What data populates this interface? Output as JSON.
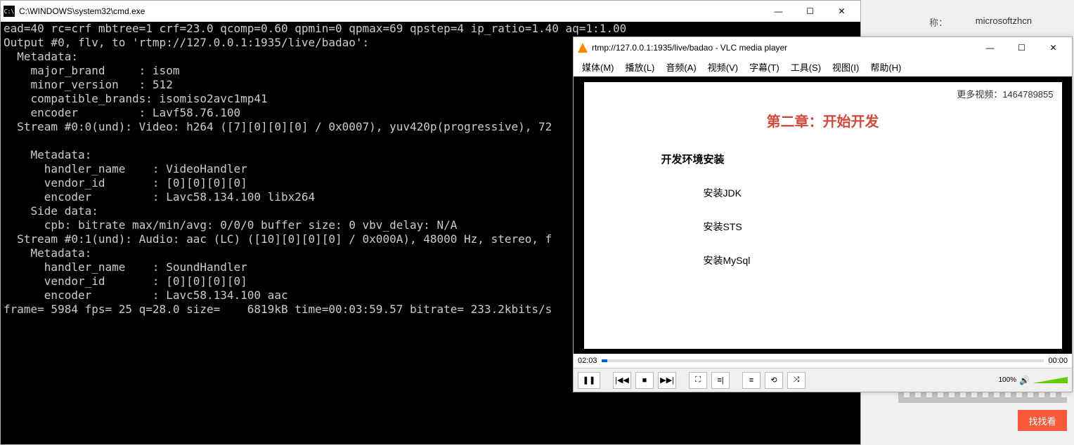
{
  "cmd": {
    "title": "C:\\WINDOWS\\system32\\cmd.exe",
    "output": "ead=40 rc=crf mbtree=1 crf=23.0 qcomp=0.60 qpmin=0 qpmax=69 qpstep=4 ip_ratio=1.40 aq=1:1.00\nOutput #0, flv, to 'rtmp://127.0.0.1:1935/live/badao':\n  Metadata:\n    major_brand     : isom\n    minor_version   : 512\n    compatible_brands: isomiso2avc1mp41\n    encoder         : Lavf58.76.100\n  Stream #0:0(und): Video: h264 ([7][0][0][0] / 0x0007), yuv420p(progressive), 72\n\n    Metadata:\n      handler_name    : VideoHandler\n      vendor_id       : [0][0][0][0]\n      encoder         : Lavc58.134.100 libx264\n    Side data:\n      cpb: bitrate max/min/avg: 0/0/0 buffer size: 0 vbv_delay: N/A\n  Stream #0:1(und): Audio: aac (LC) ([10][0][0][0] / 0x000A), 48000 Hz, stereo, f\n    Metadata:\n      handler_name    : SoundHandler\n      vendor_id       : [0][0][0][0]\n      encoder         : Lavc58.134.100 aac\nframe= 5984 fps= 25 q=28.0 size=    6819kB time=00:03:59.57 bitrate= 233.2kbits/s"
  },
  "vlc": {
    "title": "rtmp://127.0.0.1:1935/live/badao - VLC media player",
    "menus": [
      "媒体(M)",
      "播放(L)",
      "音频(A)",
      "视频(V)",
      "字幕(T)",
      "工具(S)",
      "视图(I)",
      "帮助(H)"
    ],
    "video": {
      "overlay": "更多视频：1464789855",
      "chapter": "第二章：开始开发",
      "section": "开发环境安装",
      "items": [
        "安装JDK",
        "安装STS",
        "安装MySql"
      ]
    },
    "time_current": "02:03",
    "time_total": "00:00",
    "volume": "100%"
  },
  "background": {
    "label": "称：",
    "value": "microsoftzhcn",
    "find_button": "找找看"
  },
  "winbtns": {
    "min": "—",
    "max": "☐",
    "close": "✕"
  }
}
